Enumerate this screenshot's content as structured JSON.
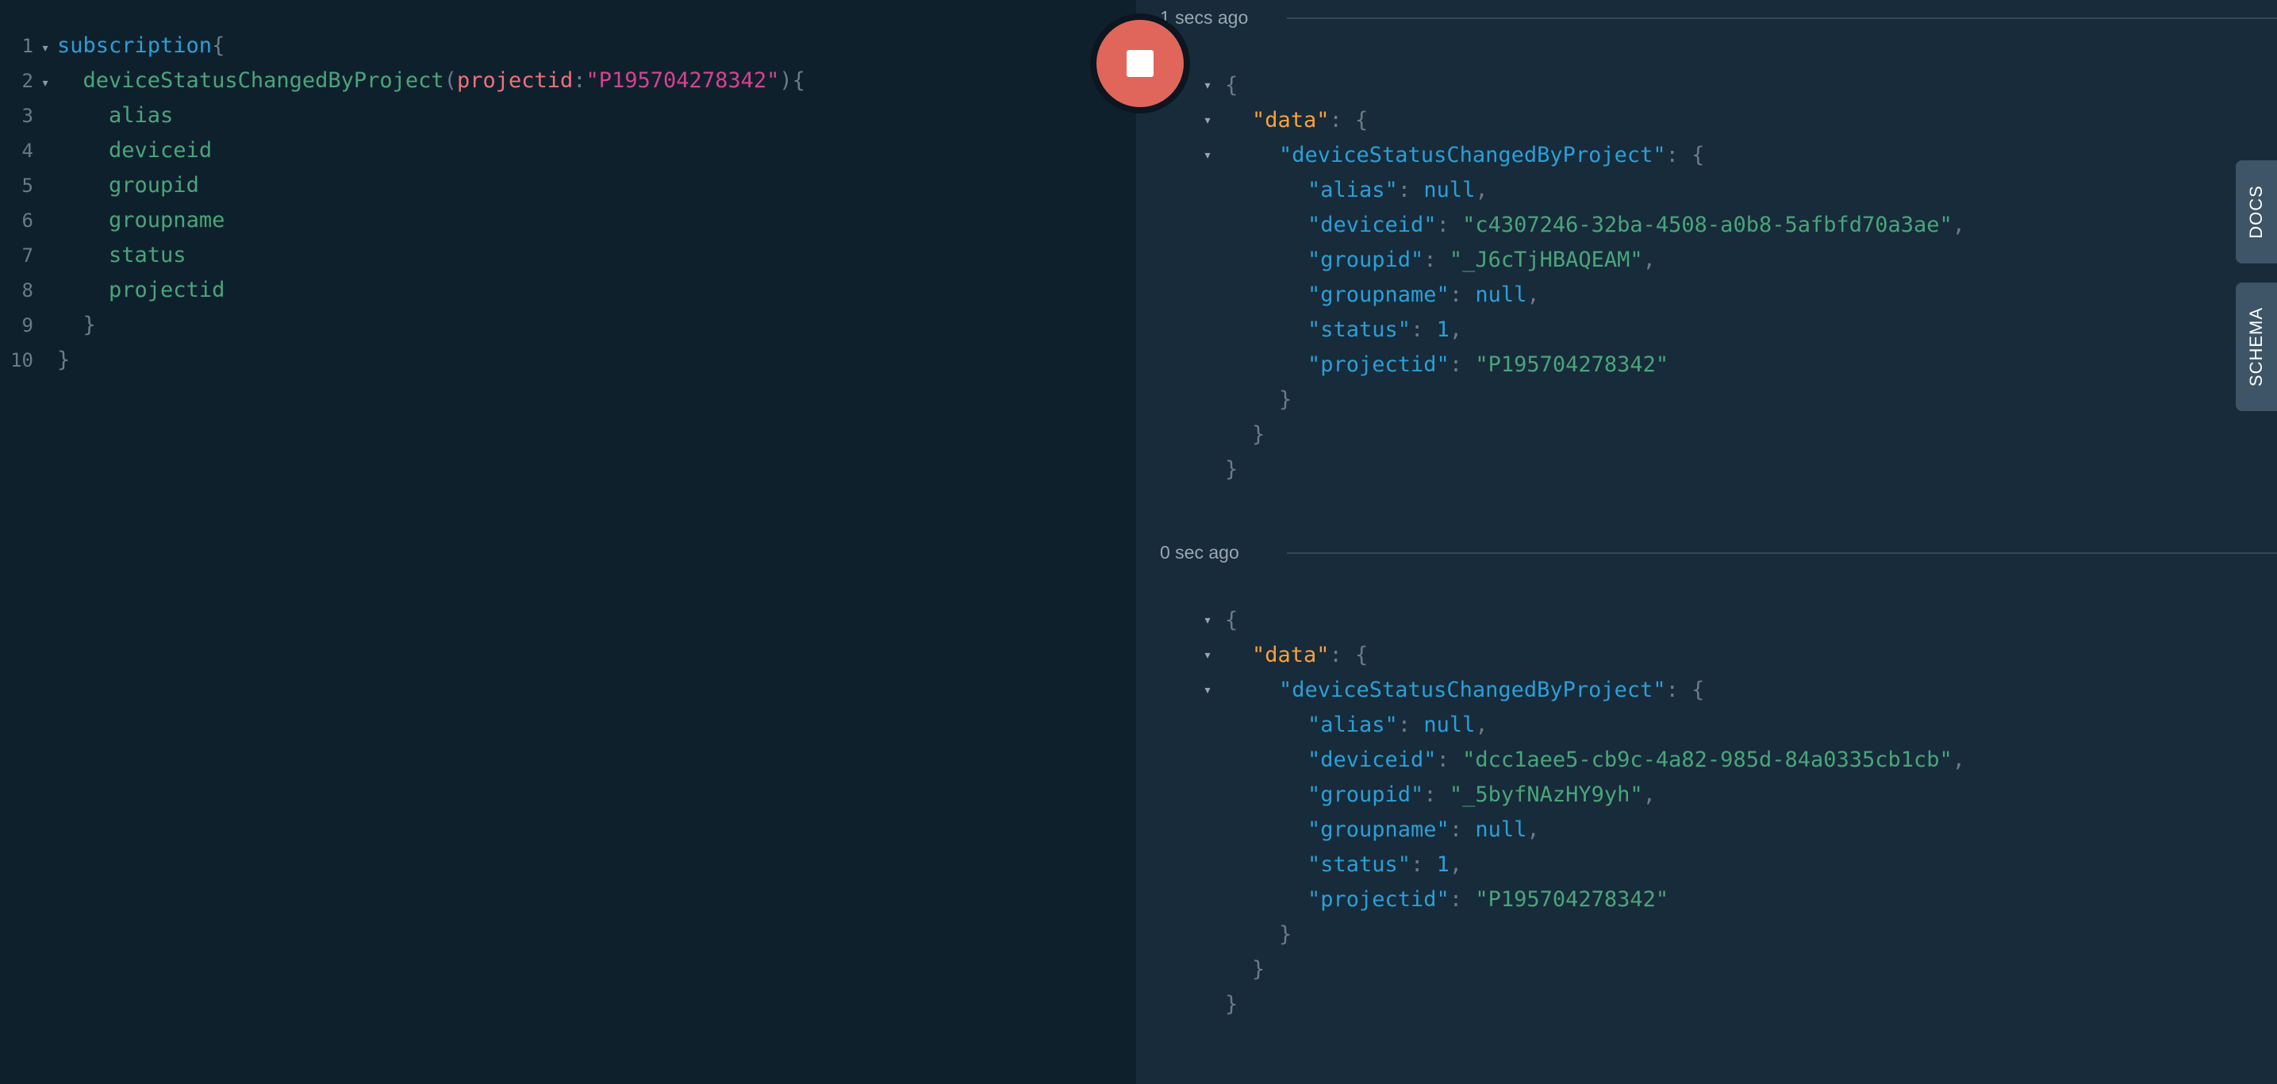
{
  "query": {
    "line_numbers": [
      "1",
      "2",
      "3",
      "4",
      "5",
      "6",
      "7",
      "8",
      "9",
      "10"
    ],
    "keyword": "subscription",
    "field": "deviceStatusChangedByProject",
    "arg_name": "projectid",
    "arg_value": "\"P195704278342\"",
    "selections": [
      "alias",
      "deviceid",
      "groupid",
      "groupname",
      "status",
      "projectid"
    ]
  },
  "run_button": {
    "state": "stop",
    "icon": "stop-icon",
    "color": "#e0665c"
  },
  "side_tabs": {
    "docs": "DOCS",
    "schema": "SCHEMA"
  },
  "results": [
    {
      "time_label": "1 secs ago",
      "data_key": "\"data\"",
      "root_key": "\"deviceStatusChangedByProject\"",
      "fields": {
        "alias": "null",
        "deviceid": "\"c4307246-32ba-4508-a0b8-5afbfd70a3ae\"",
        "groupid": "\"_J6cTjHBAQEAM\"",
        "groupname": "null",
        "status": "1",
        "projectid": "\"P195704278342\""
      }
    },
    {
      "time_label": "0 sec ago",
      "data_key": "\"data\"",
      "root_key": "\"deviceStatusChangedByProject\"",
      "fields": {
        "alias": "null",
        "deviceid": "\"dcc1aee5-cb9c-4a82-985d-84a0335cb1cb\"",
        "groupid": "\"_5byfNAzHY9yh\"",
        "groupname": "null",
        "status": "1",
        "projectid": "\"P195704278342\""
      }
    }
  ]
}
